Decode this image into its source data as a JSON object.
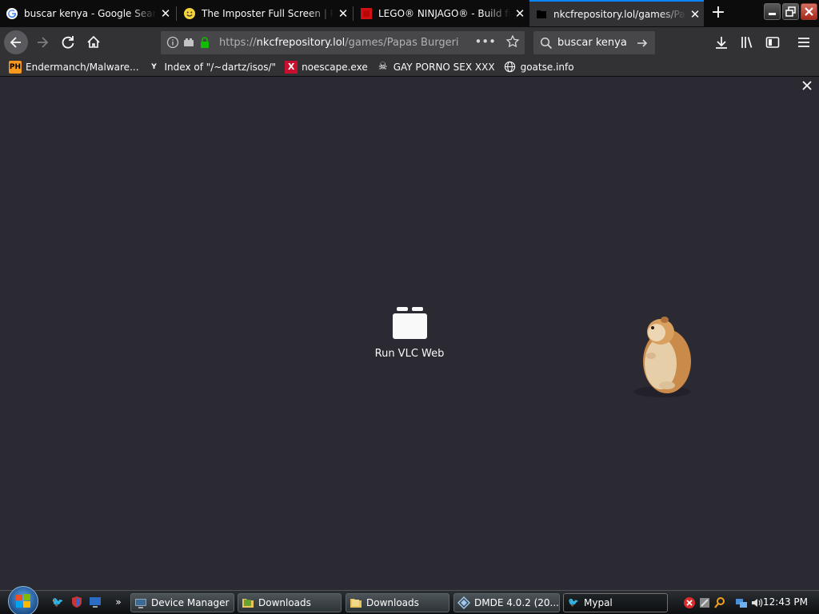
{
  "browser": {
    "tabs": [
      {
        "title": "buscar kenya - Google Search",
        "favicon": "google-icon"
      },
      {
        "title": "The Imposter Full Screen | Prim",
        "favicon": "smiley-icon"
      },
      {
        "title": "LEGO® NINJAGO® - Build fun",
        "favicon": "lego-icon"
      },
      {
        "title": "nkcfrepository.lol/games/Papa",
        "favicon": "page-icon",
        "active": true
      }
    ],
    "url": {
      "prefix": "https://",
      "host": "nkcfrepository.lol",
      "path": "/games/Papas Burgeria"
    },
    "search": {
      "value": "buscar kenya"
    },
    "bookmarks": [
      {
        "label": "Endermanch/Malware...",
        "icon": "pornhub-icon",
        "icon_text": "PH"
      },
      {
        "label": "Index of \"/~dartz/isos/\"",
        "icon": "ycombinator-icon",
        "icon_text": "Y"
      },
      {
        "label": "noescape.exe",
        "icon": "x-icon",
        "icon_text": "X"
      },
      {
        "label": "GAY PORNO SEX XXX",
        "icon": "skull-icon",
        "icon_text": "☠"
      },
      {
        "label": "goatse.info",
        "icon": "globe-icon",
        "icon_text": "🌐"
      }
    ]
  },
  "page": {
    "vlc_label": "Run VLC Web"
  },
  "taskbar": {
    "items": [
      {
        "label": "Device Manager",
        "icon": "device-manager-icon"
      },
      {
        "label": "Downloads",
        "icon": "folder-icon"
      },
      {
        "label": "Downloads",
        "icon": "folder-icon"
      },
      {
        "label": "DMDE 4.0.2 (20...",
        "icon": "dmde-icon"
      },
      {
        "label": "Mypal",
        "icon": "mypal-icon",
        "active": true
      }
    ],
    "clock": "12:43 PM"
  },
  "colors": {
    "accent": "#0a84ff",
    "page_bg": "#2b2a33",
    "toolbar_bg": "#323234",
    "tabstrip_bg": "#0c0c0d"
  }
}
